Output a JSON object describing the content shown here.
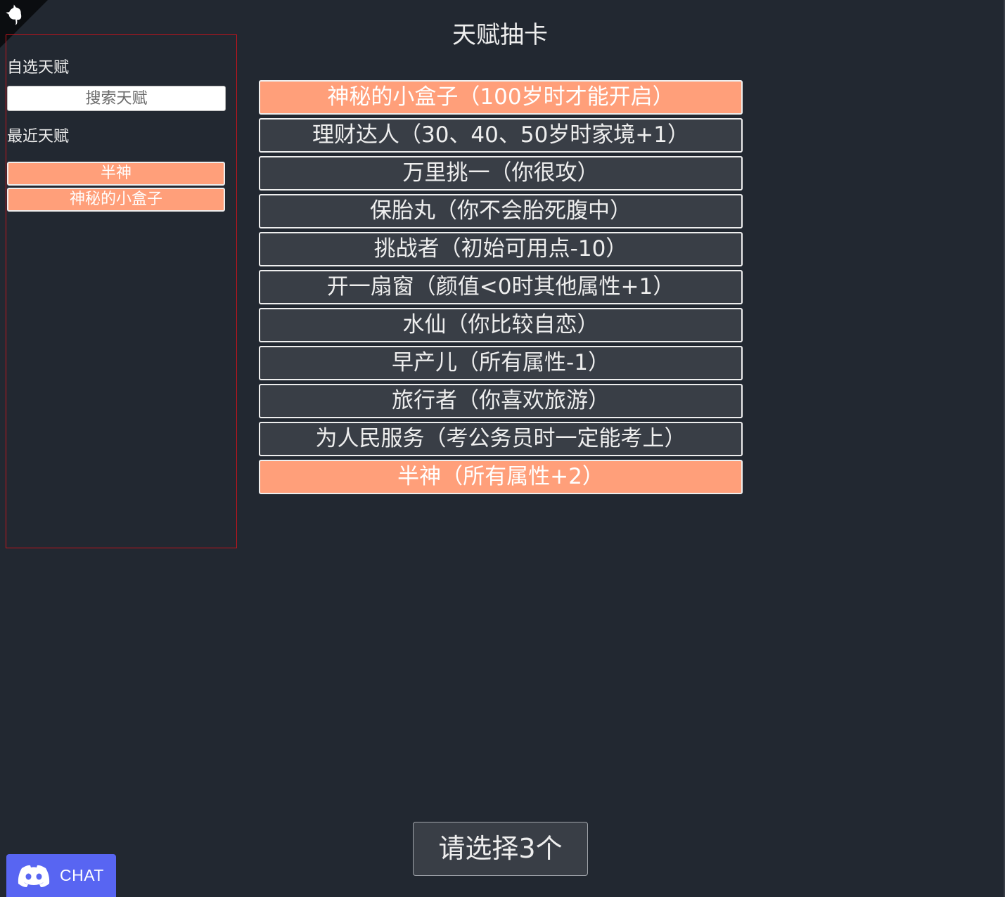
{
  "header": {
    "title": "天赋抽卡",
    "corner_icon": "github-octocat-icon"
  },
  "sidebar": {
    "custom_heading": "自选天赋",
    "search_placeholder": "搜索天赋",
    "recent_heading": "最近天赋",
    "recent_items": [
      {
        "label": "半神"
      },
      {
        "label": "神秘的小盒子"
      }
    ]
  },
  "talents": [
    {
      "label": "神秘的小盒子（100岁时才能开启）",
      "selected": true
    },
    {
      "label": "理财达人（30、40、50岁时家境+1）",
      "selected": false
    },
    {
      "label": "万里挑一（你很攻）",
      "selected": false
    },
    {
      "label": "保胎丸（你不会胎死腹中）",
      "selected": false
    },
    {
      "label": "挑战者（初始可用点-10）",
      "selected": false
    },
    {
      "label": "开一扇窗（颜值<0时其他属性+1）",
      "selected": false
    },
    {
      "label": "水仙（你比较自恋）",
      "selected": false
    },
    {
      "label": "早产儿（所有属性-1）",
      "selected": false
    },
    {
      "label": "旅行者（你喜欢旅游）",
      "selected": false
    },
    {
      "label": "为人民服务（考公务员时一定能考上）",
      "selected": false
    },
    {
      "label": "半神（所有属性+2）",
      "selected": true
    }
  ],
  "confirm_button": {
    "label": "请选择3个"
  },
  "chat": {
    "label": "CHAT",
    "icon": "discord-icon",
    "color": "#5865f2"
  },
  "colors": {
    "background": "#222831",
    "item": "#393e46",
    "selected": "#ff9f7a",
    "sidebar_border": "#c0141c"
  }
}
